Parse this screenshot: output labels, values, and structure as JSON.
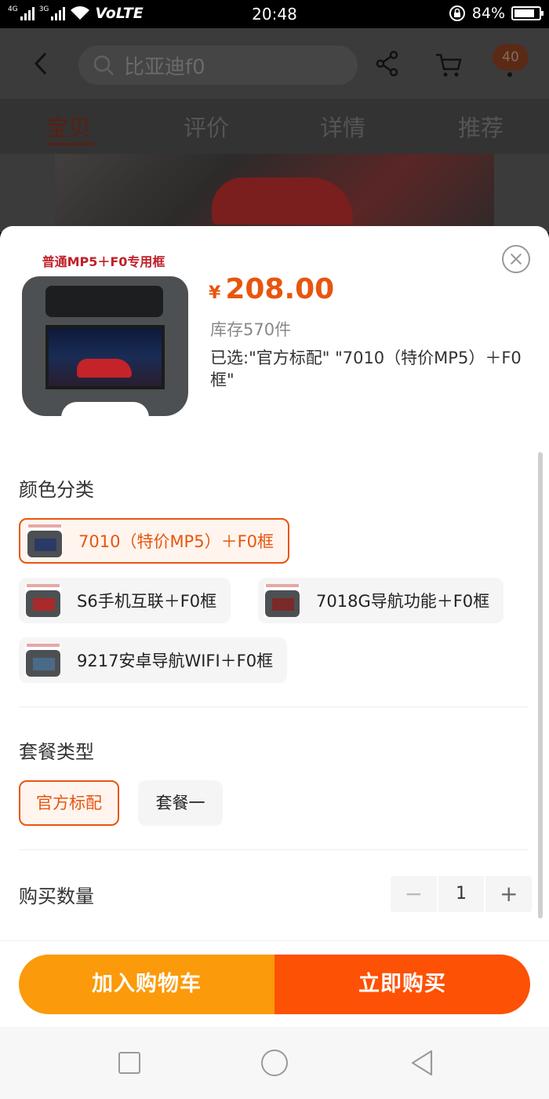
{
  "status_bar": {
    "sim1_tag": "4G",
    "sim2_tag": "3G",
    "network_label": "VoLTE",
    "time": "20:48",
    "battery_percent_text": "84%",
    "battery_level": 0.84
  },
  "background_page": {
    "search": {
      "placeholder": "比亚迪f0"
    },
    "cart_badge": "40",
    "tabs": [
      {
        "label": "宝贝",
        "active": true
      },
      {
        "label": "评价",
        "active": false
      },
      {
        "label": "详情",
        "active": false
      },
      {
        "label": "推荐",
        "active": false
      }
    ]
  },
  "sku_sheet": {
    "product_image_caption": "普通MP5＋F0专用框",
    "price": {
      "currency": "¥",
      "amount": "208.00",
      "color": "#e8550f"
    },
    "stock": "库存570件",
    "selected_text": "已选:\"官方标配\" \"7010（特价MP5）＋F0框\"",
    "color_section": {
      "title": "颜色分类",
      "options": [
        {
          "label": "7010（特价MP5）＋F0框",
          "active": true
        },
        {
          "label": "S6手机互联＋F0框",
          "active": false
        },
        {
          "label": "7018G导航功能＋F0框",
          "active": false
        },
        {
          "label": "9217安卓导航WIFI＋F0框",
          "active": false
        }
      ]
    },
    "package_section": {
      "title": "套餐类型",
      "options": [
        {
          "label": "官方标配",
          "active": true
        },
        {
          "label": "套餐一",
          "active": false
        }
      ]
    },
    "quantity_section": {
      "title": "购买数量",
      "minus": "−",
      "value": "1",
      "plus": "+"
    },
    "buttons": {
      "add_to_cart": "加入购物车",
      "buy_now": "立即购买",
      "add_to_cart_color": "#fb9a0a",
      "buy_now_color": "#fd5105"
    }
  },
  "icons": [
    "back-arrow-icon",
    "search-icon",
    "share-icon",
    "cart-icon",
    "close-icon",
    "nav-recents-icon",
    "nav-home-icon",
    "nav-back-icon"
  ]
}
